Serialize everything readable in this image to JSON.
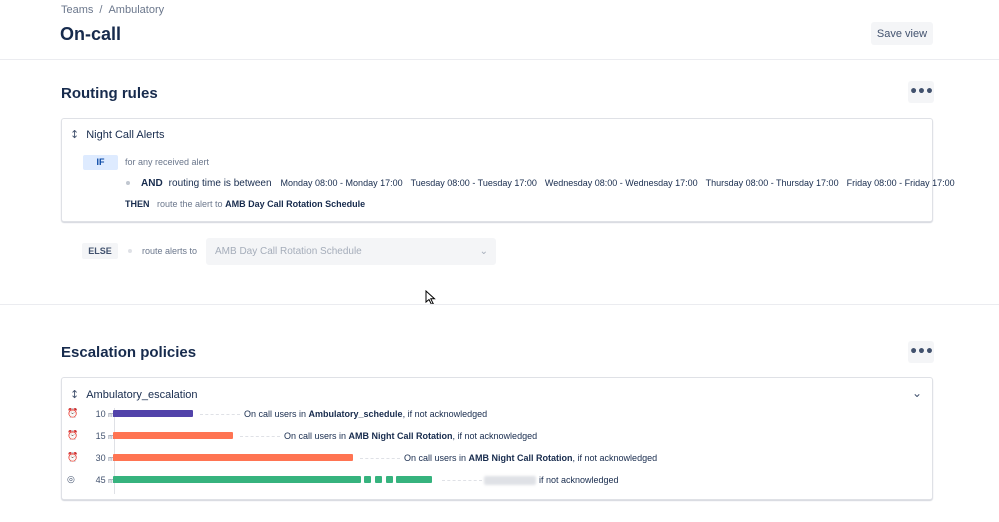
{
  "breadcrumb": [
    "Teams",
    "/",
    "Ambulatory"
  ],
  "page": {
    "title": "On-call",
    "save_view": "Save view"
  },
  "routing": {
    "title": "Routing rules",
    "more_label": "•••",
    "rule": {
      "name": "Night Call Alerts",
      "if_label": "IF",
      "if_text": "for any received alert",
      "and_label": "AND",
      "condition": "routing time is between",
      "slots": [
        "Monday 08:00 - Monday 17:00",
        "Tuesday 08:00 - Tuesday 17:00",
        "Wednesday 08:00 - Wednesday 17:00",
        "Thursday 08:00 - Thursday 17:00",
        "Friday 08:00 - Friday 17:00"
      ],
      "then_label": "THEN",
      "then_text": "route the alert to",
      "then_target": "AMB Day Call Rotation Schedule"
    },
    "else": {
      "label": "ELSE",
      "text": "route alerts to",
      "selected": "AMB Day Call Rotation Schedule"
    }
  },
  "escalation": {
    "title": "Escalation policies",
    "more_label": "•••",
    "policy": {
      "name": "Ambulatory_escalation",
      "steps": [
        {
          "time": "10",
          "unit": "m",
          "icon": "clock-icon",
          "color": "#5243aa",
          "prefix": "On call users in ",
          "target": "Ambulatory_schedule",
          "suffix": ", if not acknowledged"
        },
        {
          "time": "15",
          "unit": "m",
          "icon": "clock-icon",
          "color": "#ff7452",
          "prefix": "On call users in ",
          "target": "AMB Night Call Rotation",
          "suffix": ", if not acknowledged"
        },
        {
          "time": "30",
          "unit": "m",
          "icon": "clock-icon",
          "color": "#ff7452",
          "prefix": "On call users in ",
          "target": "AMB Night Call Rotation",
          "suffix": ", if not acknowledged"
        },
        {
          "time": "45",
          "unit": "m",
          "icon": "repeat-icon",
          "color": "#36b37e",
          "prefix": "",
          "target": "",
          "suffix": "if not acknowledged"
        }
      ]
    }
  }
}
